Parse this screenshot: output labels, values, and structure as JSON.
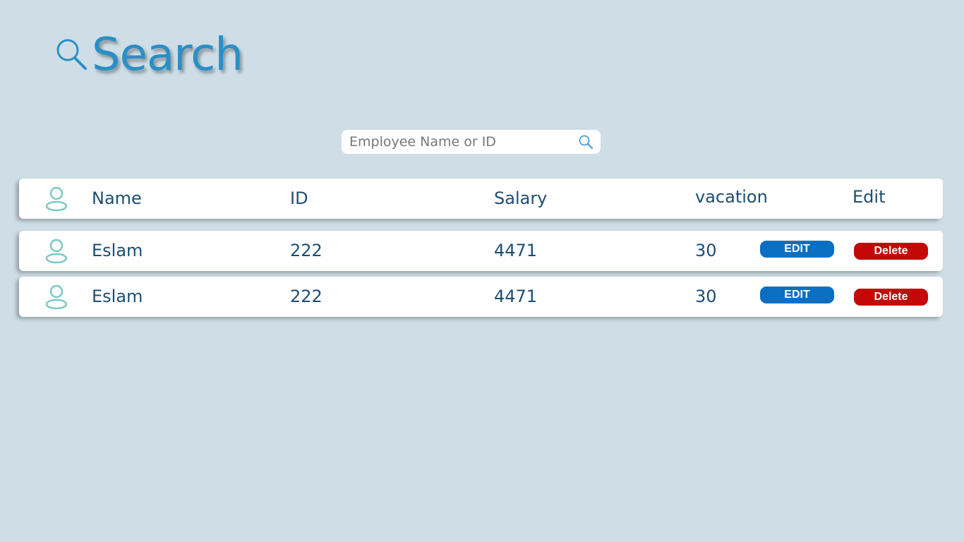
{
  "header": {
    "title": "Search",
    "icon": "search-icon",
    "color": "#2a8fc7"
  },
  "search": {
    "placeholder": "Employee Name or ID",
    "value": "",
    "icon": "search-icon"
  },
  "table": {
    "columns": [
      "Name",
      "ID",
      "Salary",
      "vacation",
      "Edit"
    ],
    "header_icon": "user-icon",
    "rows": [
      {
        "name": "Eslam",
        "id": "222",
        "salary": "4471",
        "vacation": "30",
        "edit_label": "EDIT",
        "delete_label": "Delete"
      },
      {
        "name": "Eslam",
        "id": "222",
        "salary": "4471",
        "vacation": "30",
        "edit_label": "EDIT",
        "delete_label": "Delete"
      }
    ]
  },
  "colors": {
    "background": "#cfdee6",
    "text": "#1d4e72",
    "edit_button": "#0a6fc2",
    "delete_button": "#c40808",
    "avatar": "#7cc8c4"
  }
}
